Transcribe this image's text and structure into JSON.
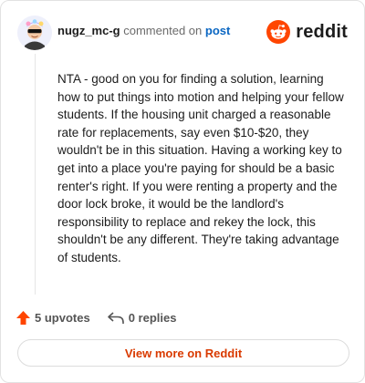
{
  "header": {
    "username": "nugz_mc-g",
    "commented_text": "commented on",
    "post_link": "post",
    "brand": "reddit"
  },
  "comment": {
    "text": "NTA - good on you for finding a solution, learning how to put things into motion and helping your fellow students. If the housing unit charged a reasonable rate for replacements, say even $10-$20, they wouldn't be in this situation. Having a working key to get into a place you're paying for should be a basic renter's right. If you were renting a property and the door lock broke, it would be the landlord's responsibility to replace and rekey the lock, this shouldn't be any different. They're taking advantage of students."
  },
  "actions": {
    "upvotes": "5 upvotes",
    "replies": "0 replies"
  },
  "footer": {
    "view_more": "View more on Reddit"
  },
  "icons": {
    "upvote": "upvote-arrow-icon",
    "reply": "reply-arrow-icon",
    "brand_logo": "reddit-snoo-icon",
    "avatar": "user-avatar"
  },
  "colors": {
    "accent": "#ff4500",
    "link": "#0a66c2",
    "view_more_text": "#d93a00"
  }
}
